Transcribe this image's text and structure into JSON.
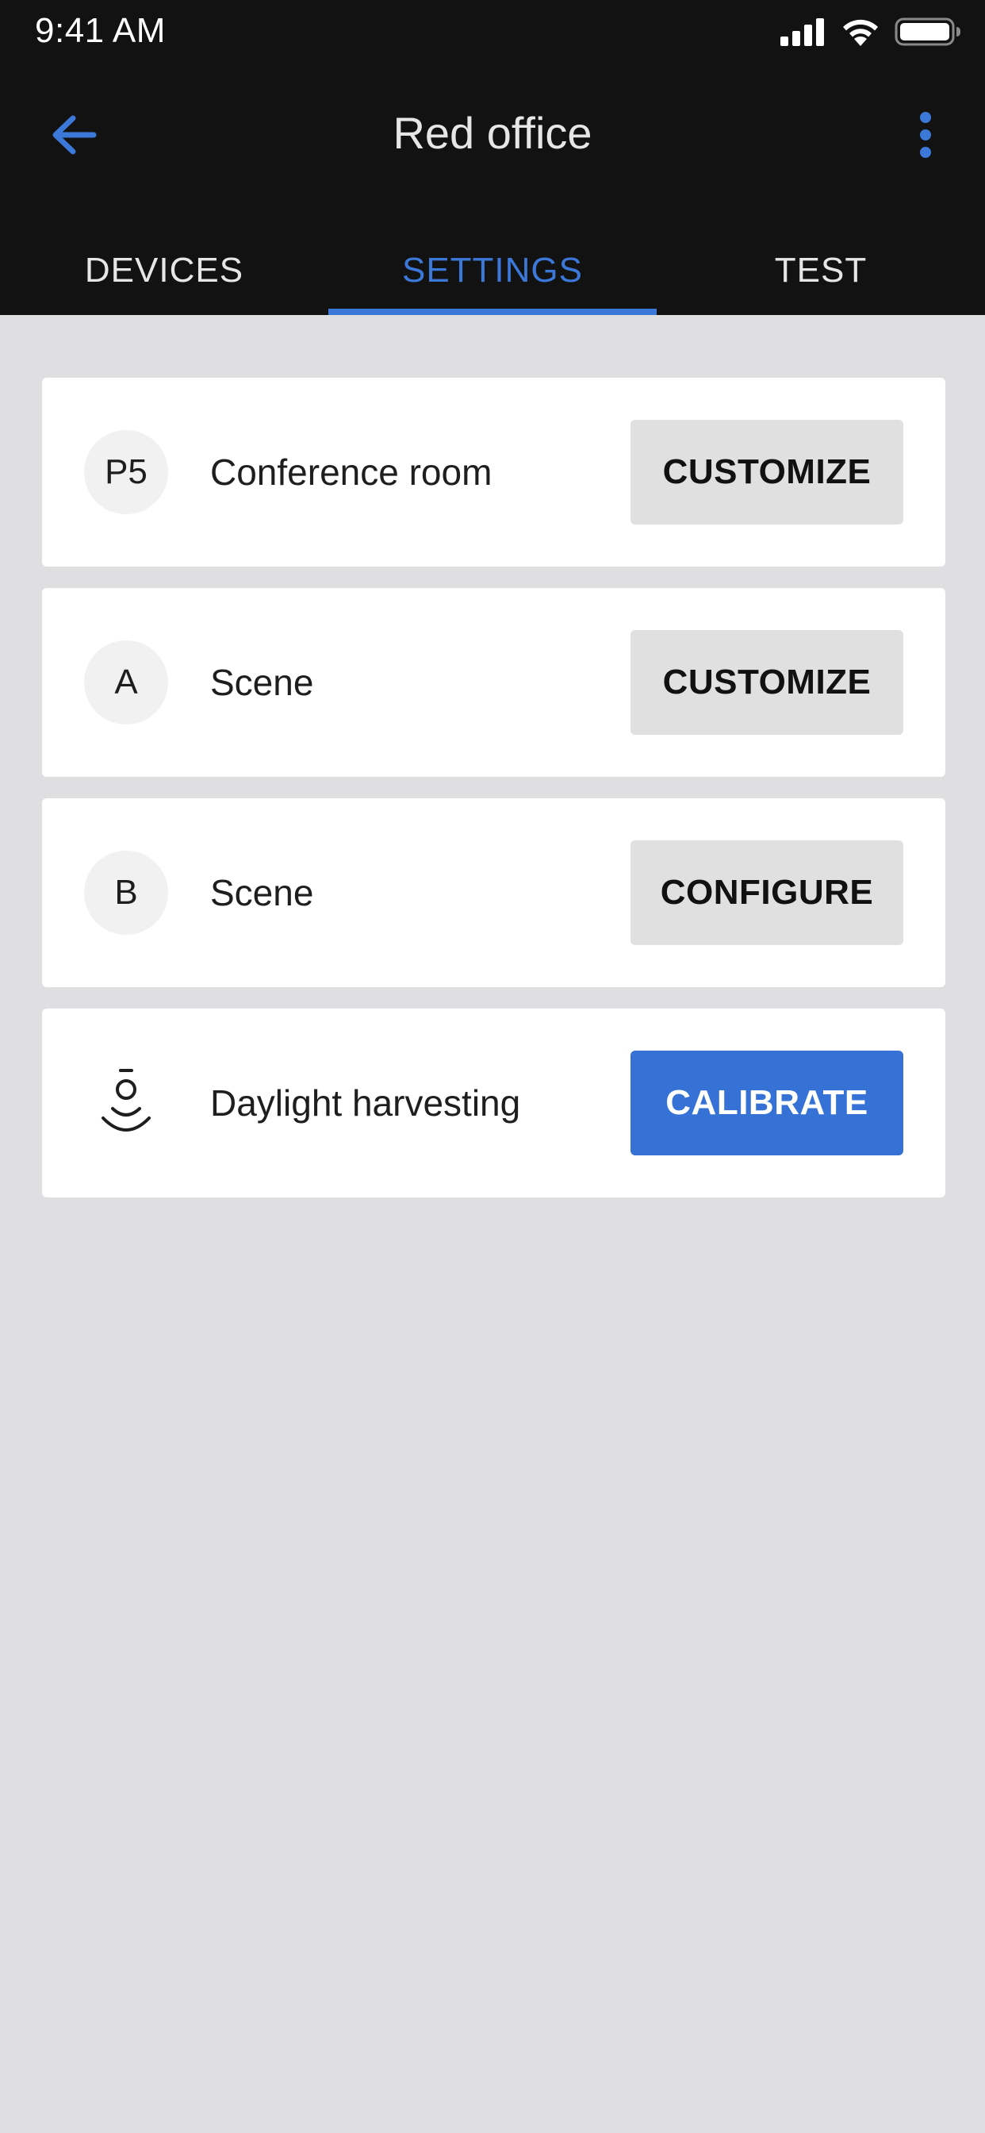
{
  "status_bar": {
    "time": "9:41 AM",
    "icons": [
      "cellular-signal-icon",
      "wifi-icon",
      "battery-icon"
    ]
  },
  "toolbar": {
    "title": "Red office",
    "back_icon": "arrow-left-icon",
    "more_icon": "more-vertical-icon"
  },
  "tabs": [
    {
      "label": "DEVICES",
      "active": false
    },
    {
      "label": "SETTINGS",
      "active": true
    },
    {
      "label": "TEST",
      "active": false
    }
  ],
  "cards": [
    {
      "badge": "P5",
      "label": "Conference room",
      "button": "CUSTOMIZE"
    },
    {
      "badge": "A",
      "label": "Scene",
      "button": "CUSTOMIZE"
    },
    {
      "badge": "B",
      "label": "Scene",
      "button": "CONFIGURE"
    },
    {
      "icon": "daylight-sensor-icon",
      "label": "Daylight harvesting",
      "button": "CALIBRATE"
    }
  ],
  "colors": {
    "header_bg": "#121213",
    "accent": "#3b78d8",
    "page_bg": "#dfdfe1",
    "card_bg": "#ffffff",
    "secondary_button_bg": "#e0e0e0",
    "primary_button_bg": "#3672d5"
  }
}
